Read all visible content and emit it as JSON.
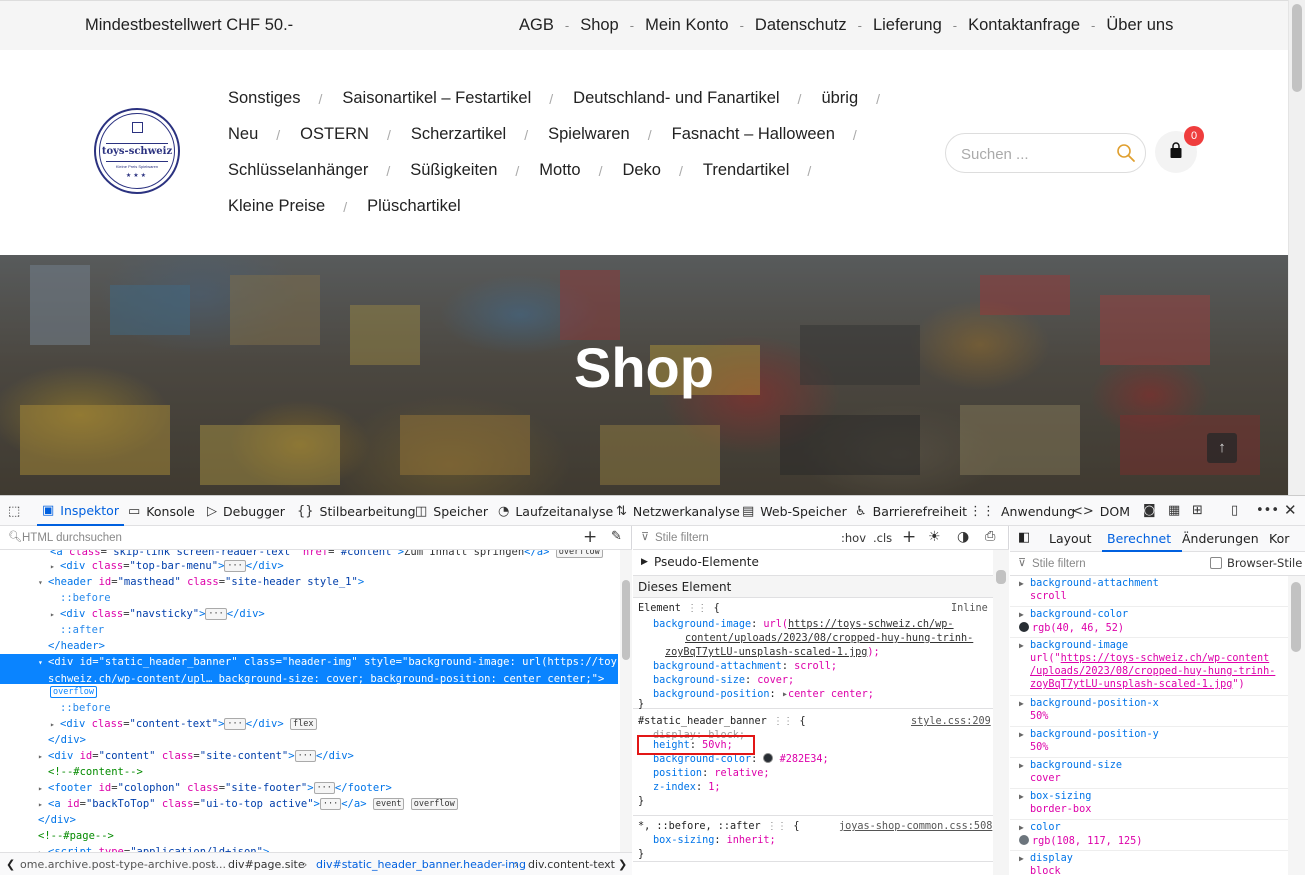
{
  "site": {
    "top_bar": {
      "min_order": "Mindestbestellwert CHF 50.-",
      "links": [
        "AGB",
        "Shop",
        "Mein Konto",
        "Datenschutz",
        "Lieferung",
        "Kontaktanfrage",
        "Über uns"
      ],
      "separator": "-"
    },
    "logo": {
      "name": "toys-schweiz",
      "tagline": "Kleine Preis Spielwaren",
      "stars": "★★★"
    },
    "main_menu": {
      "row1": [
        "Sonstiges",
        "Saisonartikel – Festartikel",
        "Deutschland- und Fanartikel",
        "übrig"
      ],
      "row2": [
        "Neu",
        "OSTERN",
        "Scherzartikel",
        "Spielwaren",
        "Fasnacht – Halloween"
      ],
      "row3": [
        "Schlüsselanhänger",
        "Süßigkeiten",
        "Motto",
        "Deko",
        "Trendartikel"
      ],
      "row4": [
        "Kleine Preise",
        "Plüschartikel"
      ],
      "separator": "/"
    },
    "search": {
      "placeholder": "Suchen ..."
    },
    "cart": {
      "count": "0"
    },
    "banner": {
      "title": "Shop"
    },
    "back_to_top": "↑"
  },
  "devtools": {
    "tabs": [
      "Inspektor",
      "Konsole",
      "Debugger",
      "Stilbearbeitung",
      "Speicher",
      "Laufzeitanalyse",
      "Netzwerkanalyse",
      "Web-Speicher",
      "Barrierefreiheit",
      "Anwendung",
      "DOM"
    ],
    "active_tab": "Inspektor",
    "markup": {
      "search_placeholder": "HTML durchsuchen",
      "breadcrumbs": [
        "ome.archive.post-type-archive.post...",
        "div#page.site",
        "div#static_header_banner.header-img",
        "div.content-text"
      ]
    },
    "rules": {
      "filter_placeholder": "Stile filtern",
      "hov": ":hov",
      "cls": ".cls",
      "pseudo_label": "Pseudo-Elemente",
      "this_element_label": "Dieses Element",
      "element_rule": {
        "selector": "Element",
        "source": "Inline",
        "bg_image_name": "background-image",
        "bg_image_value_1": "url(",
        "bg_image_url_1": "https://toys-schweiz.ch/wp-",
        "bg_image_url_2": "content/uploads/2023/08/cropped-huy-hung-trinh-",
        "bg_image_url_3": "zoyBqT7ytLU-unsplash-scaled-1.jpg",
        "bg_image_end": ");",
        "bg_attach_name": "background-attachment",
        "bg_attach_value": "scroll;",
        "bg_size_name": "background-size",
        "bg_size_value": "cover;",
        "bg_pos_name": "background-position",
        "bg_pos_value": "center center;"
      },
      "banner_rule": {
        "selector": "#static_header_banner",
        "source": "style.css:209",
        "display_name": "display",
        "display_value": "block;",
        "height_name": "height",
        "height_value": "50vh;",
        "bgcolor_name": "background-color",
        "bgcolor_value": "#282E34;",
        "position_name": "position",
        "position_value": "relative;",
        "zindex_name": "z-index",
        "zindex_value": "1;"
      },
      "universal_rule": {
        "selector": "*, ::before, ::after",
        "source": "joyas-shop-common.css:508",
        "prop_name": "box-sizing",
        "prop_value": "inherit;"
      }
    },
    "computed": {
      "tabs": [
        "Layout",
        "Berechnet",
        "Änderungen",
        "Kor"
      ],
      "active_tab": "Berechnet",
      "filter_placeholder": "Stile filtern",
      "browser_styles_label": "Browser-Stile",
      "items": [
        {
          "name": "background-attachment",
          "value": "scroll"
        },
        {
          "name": "background-color",
          "value": "rgb(40, 46, 52)",
          "swatch": "#282e34"
        },
        {
          "name": "background-image",
          "value_prefix": "url(\"",
          "url1": "https://toys-schweiz.ch/wp-content",
          "url2": "/uploads/2023/08/cropped-huy-hung-trinh-",
          "url3": "zoyBqT7ytLU-unsplash-scaled-1.jpg",
          "value_suffix": "\")"
        },
        {
          "name": "background-position-x",
          "value": "50%"
        },
        {
          "name": "background-position-y",
          "value": "50%"
        },
        {
          "name": "background-size",
          "value": "cover"
        },
        {
          "name": "box-sizing",
          "value": "border-box"
        },
        {
          "name": "color",
          "value": "rgb(108, 117, 125)",
          "swatch": "#6c757d"
        },
        {
          "name": "display",
          "value": "block"
        }
      ]
    }
  },
  "colors": {
    "devtools_blue": "#0060df",
    "selection": "#0a84ff",
    "cart_badge": "#ef3d3d",
    "brand": "#2b3280"
  }
}
